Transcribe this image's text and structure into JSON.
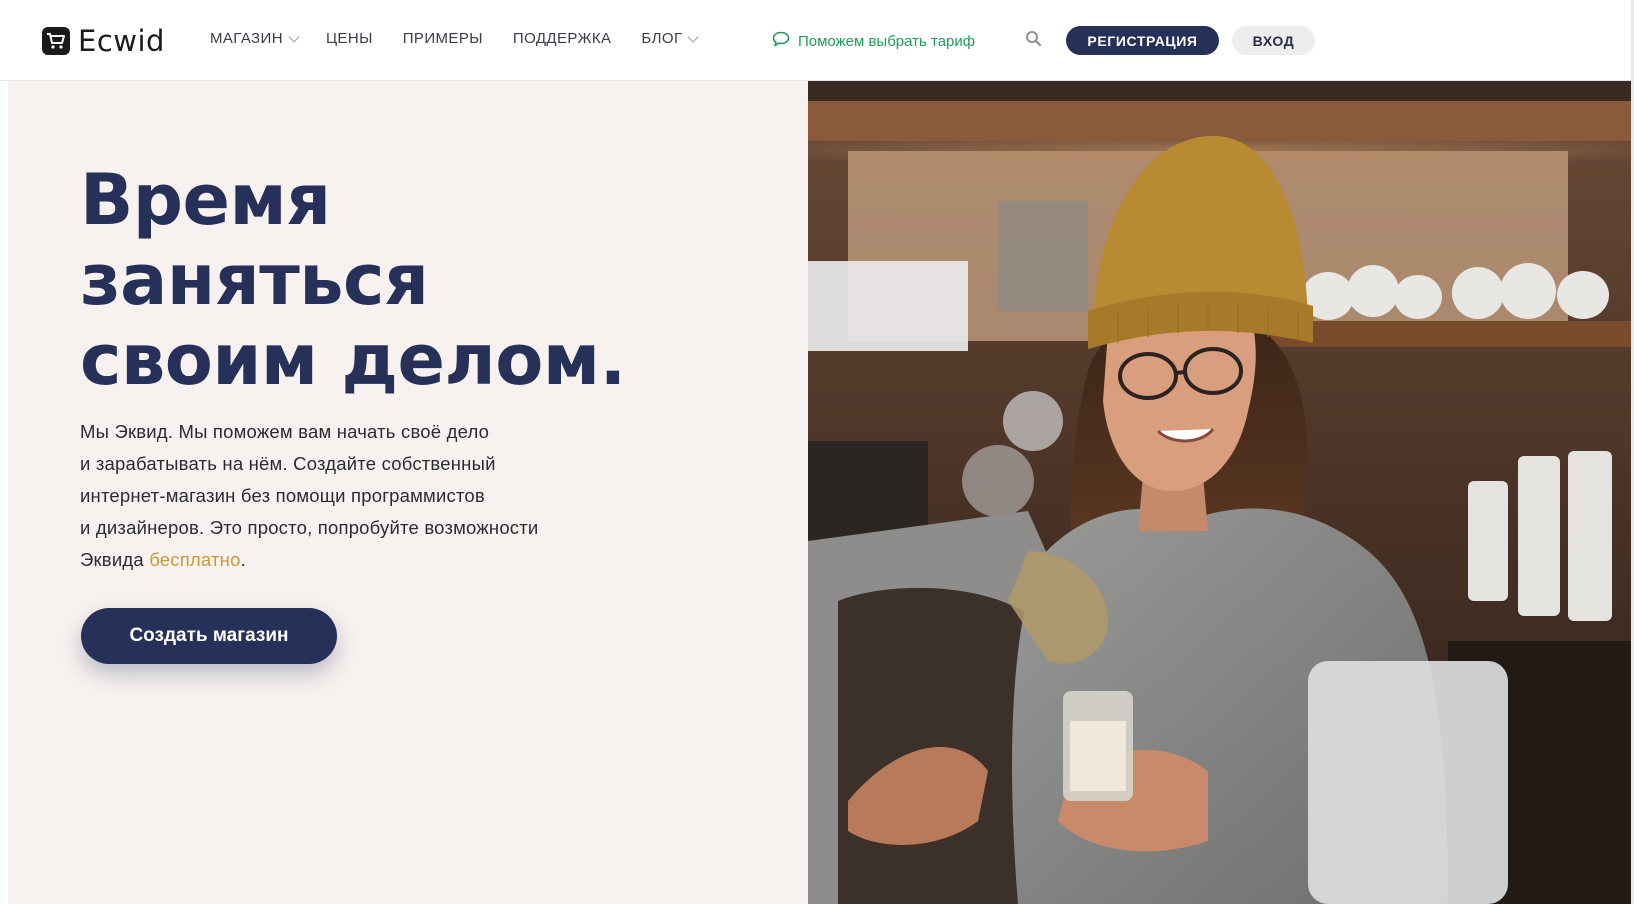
{
  "brand": {
    "name": "Ecwid"
  },
  "nav": {
    "items": [
      {
        "label": "МАГАЗИН",
        "dropdown": true
      },
      {
        "label": "ЦЕНЫ",
        "dropdown": false
      },
      {
        "label": "ПРИМЕРЫ",
        "dropdown": false
      },
      {
        "label": "ПОДДЕРЖКА",
        "dropdown": false
      },
      {
        "label": "БЛОГ",
        "dropdown": true
      }
    ],
    "help_label": "Поможем выбрать тариф",
    "register_label": "РЕГИСТРАЦИЯ",
    "login_label": "ВХОД"
  },
  "hero": {
    "title_lines": [
      "Время",
      "заняться",
      "своим делом."
    ],
    "text_lines": [
      "Мы Эквид. Мы поможем вам начать своё дело",
      "и зарабатывать на нём. Создайте собственный",
      "интернет-магазин без помощи программистов",
      "и дизайнеров. Это просто, попробуйте возможности"
    ],
    "text_last_prefix": "Эквида ",
    "text_last_link": "бесплатно",
    "text_last_suffix": ".",
    "cta_label": "Создать магазин"
  },
  "colors": {
    "navy": "#263058",
    "accent_gold": "#c99a36",
    "help_green": "#1e9c5a",
    "hero_bg": "#f7f2ef"
  }
}
